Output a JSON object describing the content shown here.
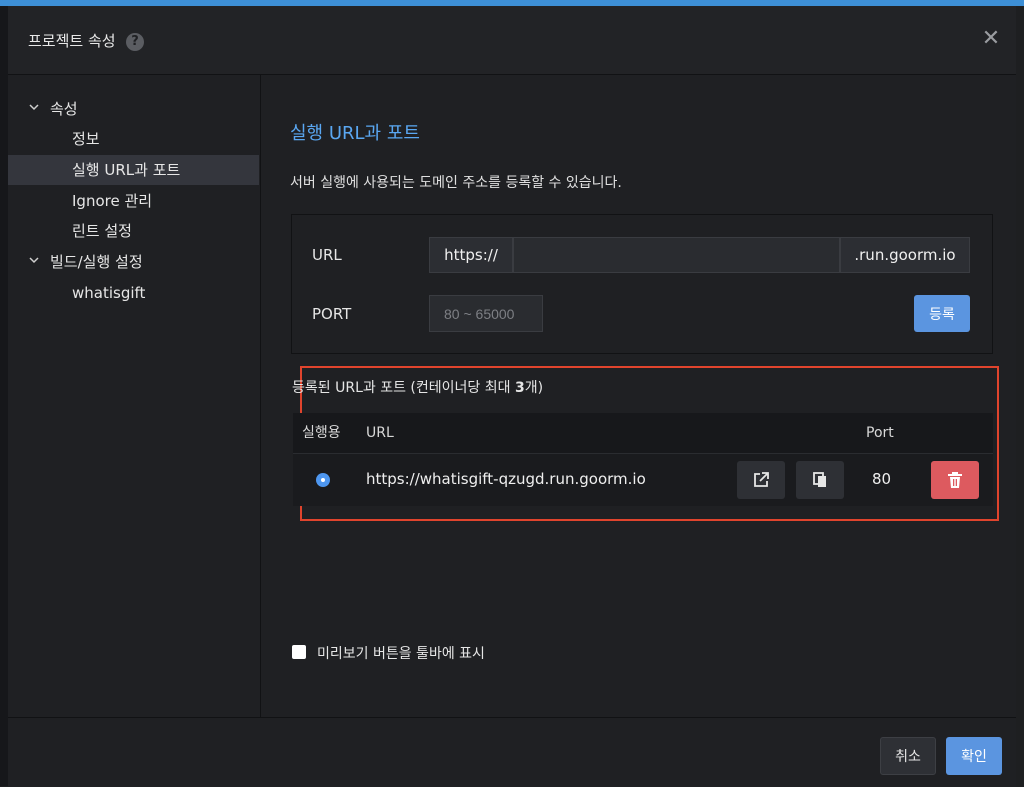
{
  "dialog": {
    "title": "프로젝트 속성",
    "help_icon": "question-circle-icon",
    "close_icon": "close-icon"
  },
  "sidebar": {
    "groups": [
      {
        "label": "속성",
        "expanded": true,
        "items": [
          {
            "label": "정보",
            "active": false
          },
          {
            "label": "실행 URL과 포트",
            "active": true
          },
          {
            "label": "Ignore 관리",
            "active": false
          },
          {
            "label": "린트 설정",
            "active": false
          }
        ]
      },
      {
        "label": "빌드/실행 설정",
        "expanded": true,
        "items": [
          {
            "label": "whatisgift",
            "active": false
          }
        ]
      }
    ]
  },
  "content": {
    "title": "실행 URL과 포트",
    "description": "서버 실행에 사용되는 도메인 주소를 등록할 수 있습니다.",
    "form": {
      "url_label": "URL",
      "url_prefix": "https://",
      "url_value": "",
      "url_suffix": ".run.goorm.io",
      "port_label": "PORT",
      "port_placeholder": "80 ~ 65000",
      "register_label": "등록"
    },
    "registered": {
      "title_prefix": "등록된 URL과 포트 (컨테이너당 최대 ",
      "max_count": "3",
      "title_suffix": "개)",
      "columns": [
        "실행용",
        "URL",
        "Port"
      ],
      "rows": [
        {
          "selected": true,
          "url": "https://whatisgift-qzugd.run.goorm.io",
          "port": "80"
        }
      ]
    },
    "preview_checkbox_label": "미리보기 버튼을 툴바에 표시",
    "preview_checked": false
  },
  "footer": {
    "cancel_label": "취소",
    "confirm_label": "확인"
  },
  "colors": {
    "accent": "#5b95e0",
    "title_blue": "#5aa7f2",
    "danger": "#dd5a5f",
    "highlight": "#e0442d"
  }
}
